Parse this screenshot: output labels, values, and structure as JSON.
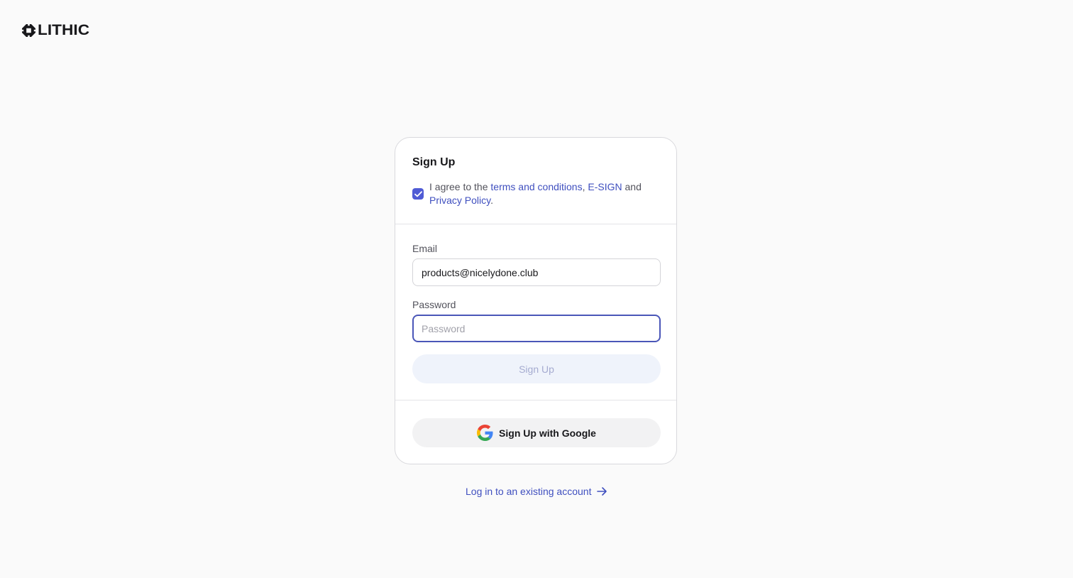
{
  "brand": {
    "name": "LITHIC",
    "logo_icon": "lithic-logo-icon"
  },
  "signup_card": {
    "title": "Sign Up",
    "agreement": {
      "checked": true,
      "prefix": "I agree to the ",
      "terms_link": "terms and conditions",
      "sep": ", ",
      "esign_link": "E-SIGN",
      "and": " and ",
      "privacy_link": "Privacy Policy",
      "suffix": "."
    },
    "email": {
      "label": "Email",
      "value": "products@nicelydone.club"
    },
    "password": {
      "label": "Password",
      "placeholder": "Password",
      "value": ""
    },
    "submit_label": "Sign Up",
    "google_label": "Sign Up with Google",
    "google_icon": "google-icon"
  },
  "login_link": {
    "label": "Log in to an existing account",
    "icon": "arrow-right-icon"
  },
  "colors": {
    "accent": "#4f5bd5",
    "link": "#3f4fbf",
    "background": "#fafafa"
  }
}
